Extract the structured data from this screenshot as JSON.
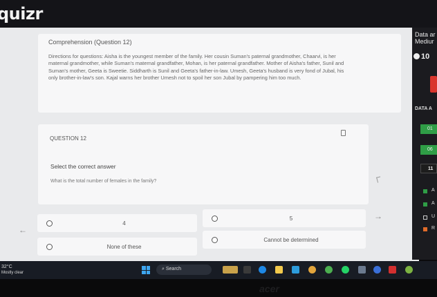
{
  "app": {
    "logo": "quizr"
  },
  "passage": {
    "title": "Comprehension (Question 12)",
    "text": "Directions for questions: Aisha is the youngest member of the family. Her cousin Suman's paternal grandmother, Chaarvi, is her maternal grandmother, while Suman's maternal grandfather, Mohan, is her paternal grandfather. Mother of Aisha's father, Sunil and Suman's mother, Geeta is Sweetie. Siddharth is Sunil and Geeta's father-in-law. Umesh, Geeta's husband is very fond of Jubal, his only brother-in-law's son. Kajal warns her brother Umesh not to spoil her son Jubal by pampering him too much."
  },
  "question": {
    "label": "QUESTION 12",
    "instruction": "Select the correct answer",
    "text": "What is the total number of females in the family?",
    "options": [
      "4",
      "5",
      "None of these",
      "Cannot be determined"
    ]
  },
  "nav": {
    "prev": "←",
    "next": "→"
  },
  "side": {
    "title": "Data ar",
    "level": "Mediur",
    "timer": "10",
    "data_label": "DATA A",
    "question_numbers": [
      "01",
      "06",
      "11"
    ],
    "legend": [
      "A",
      "A",
      "U",
      "R"
    ]
  },
  "taskbar": {
    "temp": "32°C",
    "weather": "Mostly clear",
    "search": "Search"
  },
  "bezel": {
    "brand": "acer"
  },
  "colors": {
    "answered": "#2f9d46",
    "review": "#e06b2a",
    "alert": "#d9352c"
  }
}
